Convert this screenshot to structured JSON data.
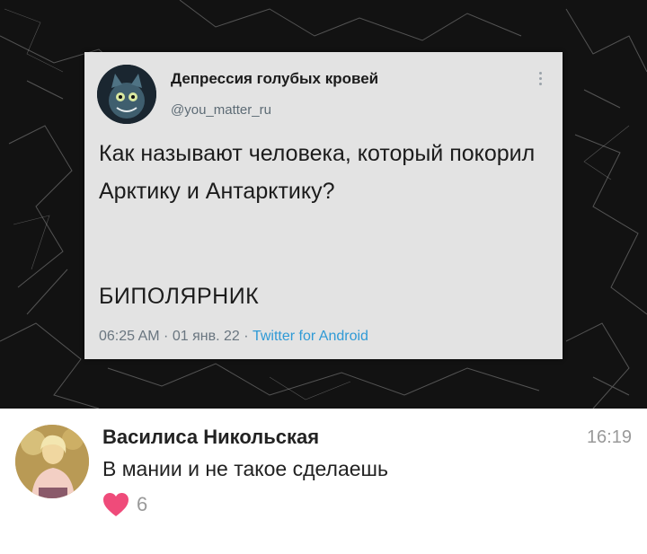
{
  "tweet": {
    "author_name": "Депрессия голубых кровей",
    "author_handle": "@you_matter_ru",
    "text": "Как называют человека, который покорил Арктику и Антарктику?",
    "punchline": "БИПОЛЯРНИК",
    "time": "06:25 AM",
    "date": "01 янв. 22",
    "separator": " · ",
    "source": "Twitter for Android",
    "more_icon": "more-vertical-icon"
  },
  "comment": {
    "author": "Василиса Никольская",
    "time": "16:19",
    "text": "В мании и не такое сделаешь",
    "likes": "6",
    "like_icon": "heart-icon",
    "like_color": "#ef4b7a"
  },
  "colors": {
    "background": "#111111",
    "card": "#e3e3e3",
    "link": "#2f9ad6"
  }
}
